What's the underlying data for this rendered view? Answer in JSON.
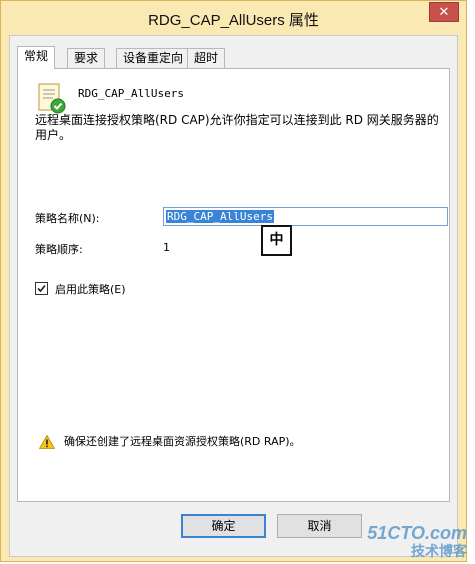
{
  "window": {
    "title": "RDG_CAP_AllUsers 属性",
    "close_glyph": "✕"
  },
  "tabs": [
    {
      "label": "常规",
      "active": true
    },
    {
      "label": "要求",
      "active": false
    },
    {
      "label": "设备重定向",
      "active": false
    },
    {
      "label": "超时",
      "active": false
    }
  ],
  "general": {
    "policy_name": "RDG_CAP_AllUsers",
    "description": "远程桌面连接授权策略(RD CAP)允许你指定可以连接到此 RD 网关服务器的用户。",
    "name_label": "策略名称(N):",
    "name_value": "RDG_CAP_AllUsers",
    "ime_indicator": "中",
    "order_label": "策略顺序:",
    "order_value": "1",
    "enable_label": "启用此策略(E)",
    "enable_checked": true,
    "warning_text": "确保还创建了远程桌面资源授权策略(RD RAP)。"
  },
  "buttons": {
    "ok": "确定",
    "cancel": "取消"
  },
  "watermark": {
    "line1": "51CTO.com",
    "line2": "技术博客"
  },
  "icons": {
    "policy": "certificate-check-icon",
    "warning": "warning-triangle-icon"
  },
  "colors": {
    "frame": "#fbe9b4",
    "close": "#c7504c",
    "selection": "#3a84d6"
  }
}
